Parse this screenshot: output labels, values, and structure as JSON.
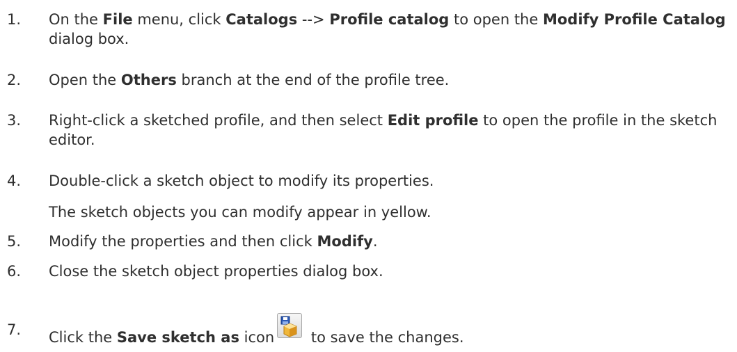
{
  "steps": [
    {
      "num": "1.",
      "parts": [
        "On the ",
        "File",
        " menu, click ",
        "Catalogs",
        " --> ",
        "Profile catalog",
        " to open the ",
        "Modify Profile Catalog",
        " dialog box."
      ]
    },
    {
      "num": "2.",
      "parts": [
        "Open the ",
        "Others",
        " branch at the end of the profile tree."
      ]
    },
    {
      "num": "3.",
      "parts": [
        "Right-click a sketched profile, and then select ",
        "Edit profile",
        " to open the profile in the sketch editor."
      ]
    },
    {
      "num": "4.",
      "parts": [
        "Double-click a sketch object to modify its properties."
      ]
    },
    {
      "num": "5.",
      "parts": [
        "Modify the properties and then click ",
        "Modify",
        "."
      ]
    },
    {
      "num": "6.",
      "parts": [
        "Close the sketch object properties dialog box."
      ]
    },
    {
      "num": "7.",
      "parts": [
        "Click the ",
        "Save sketch as",
        " icon",
        " to save the changes."
      ]
    }
  ],
  "note": "The sketch objects you can modify appear in yellow.",
  "icons": {
    "save_sketch": "save-sketch-icon"
  }
}
